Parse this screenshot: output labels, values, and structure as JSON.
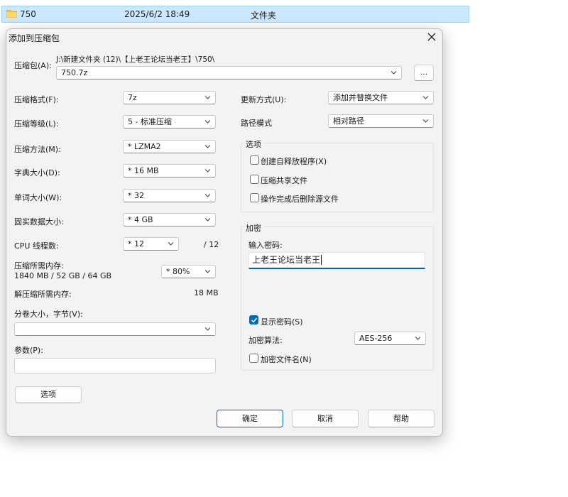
{
  "explorer": {
    "folder_name": "750",
    "modified": "2025/6/2 18:49",
    "type": "文件夹"
  },
  "dialog": {
    "title": "添加到压缩包",
    "archive": {
      "label": "压缩包(A):",
      "path": "J:\\新建文件夹 (12)\\【上老王论坛当老王】\\750\\",
      "name": "750.7z",
      "browse_label": "..."
    },
    "left": {
      "format": {
        "label": "压缩格式(F):",
        "value": "7z"
      },
      "level": {
        "label": "压缩等级(L):",
        "value": "5 - 标准压缩"
      },
      "method": {
        "label": "压缩方法(M):",
        "value": "* LZMA2"
      },
      "dict": {
        "label": "字典大小(D):",
        "value": "* 16 MB"
      },
      "word": {
        "label": "单词大小(W):",
        "value": "* 32"
      },
      "solid": {
        "label": "固实数据大小:",
        "value": "* 4 GB"
      },
      "cpu": {
        "label": "CPU 线程数:",
        "value": "* 12",
        "max": "/ 12"
      },
      "mem": {
        "label": "压缩所需内存:",
        "detail": "1840 MB / 52 GB / 64 GB",
        "value": "* 80%"
      },
      "decomp": {
        "label": "解压缩所需内存:",
        "value": "18 MB"
      },
      "split": {
        "label": "分卷大小，字节(V):",
        "value": ""
      },
      "params": {
        "label": "参数(P):",
        "value": ""
      }
    },
    "right": {
      "update": {
        "label": "更新方式(U):",
        "value": "添加并替换文件"
      },
      "path_mode": {
        "label": "路径模式",
        "value": "相对路径"
      },
      "options": {
        "title": "选项",
        "sfx": "创建自释放程序(X)",
        "shared": "压缩共享文件",
        "delete": "操作完成后删除源文件"
      },
      "encryption": {
        "title": "加密",
        "pwd_label": "输入密码:",
        "pwd_value": "上老王论坛当老王",
        "show_pwd": "显示密码(S)",
        "method_label": "加密算法:",
        "method_value": "AES-256",
        "encrypt_names": "加密文件名(N)"
      }
    },
    "buttons": {
      "options": "选项",
      "ok": "确定",
      "cancel": "取消",
      "help": "帮助"
    }
  }
}
